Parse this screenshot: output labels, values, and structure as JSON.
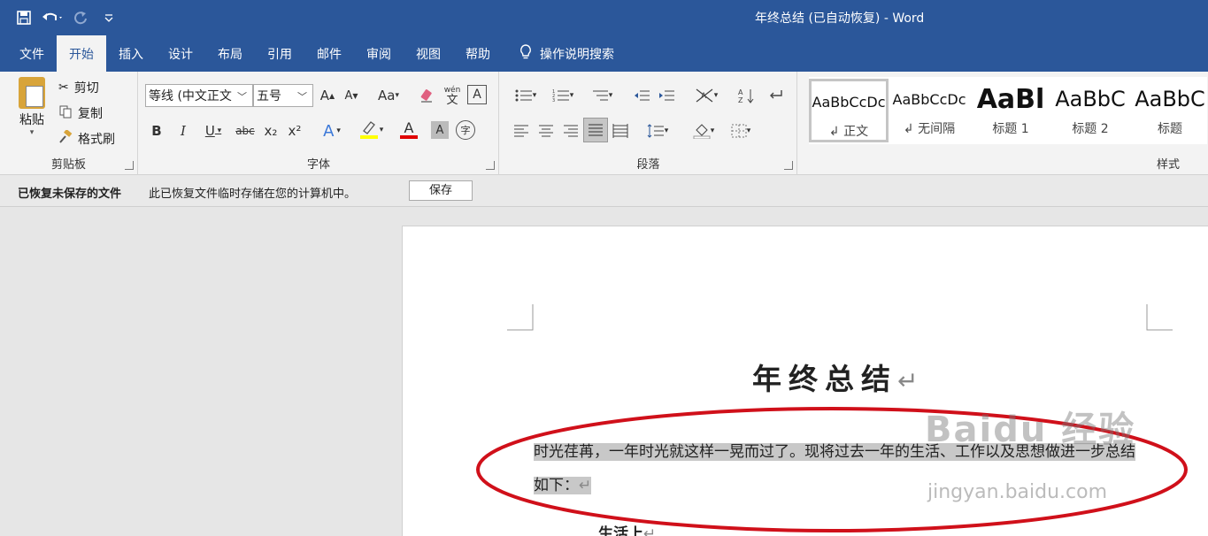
{
  "window": {
    "title": "年终总结 (已自动恢复)  -  Word"
  },
  "qat": {
    "save_icon": "save-icon",
    "undo_icon": "undo-icon",
    "redo_icon": "redo-icon",
    "customize_icon": "chevron-down-icon"
  },
  "tabs": [
    {
      "label": "文件"
    },
    {
      "label": "开始",
      "active": true
    },
    {
      "label": "插入"
    },
    {
      "label": "设计"
    },
    {
      "label": "布局"
    },
    {
      "label": "引用"
    },
    {
      "label": "邮件"
    },
    {
      "label": "审阅"
    },
    {
      "label": "视图"
    },
    {
      "label": "帮助"
    }
  ],
  "tell_me": {
    "label": "操作说明搜索",
    "icon": "lightbulb-icon"
  },
  "clipboard": {
    "paste": "粘贴",
    "cut": "剪切",
    "copy": "复制",
    "format_painter": "格式刷",
    "group_label": "剪贴板"
  },
  "font": {
    "font_name": "等线 (中文正文",
    "font_size": "五号",
    "group_label": "字体",
    "bold": "B",
    "italic": "I",
    "underline": "U",
    "strike": "abc",
    "subscript": "x₂",
    "superscript": "x²",
    "change_case": "Aa",
    "phonetic_top": "wén",
    "phonetic_bottom": "文",
    "char_border": "A",
    "grow": "A",
    "shrink": "A"
  },
  "paragraph": {
    "group_label": "段落"
  },
  "styles": {
    "group_label": "样式",
    "items": [
      {
        "preview": "AaBbCcDc",
        "name": "↲ 正文"
      },
      {
        "preview": "AaBbCcDc",
        "name": "↲ 无间隔"
      },
      {
        "preview": "AaBl",
        "name": "标题 1"
      },
      {
        "preview": "AaBbC",
        "name": "标题 2"
      },
      {
        "preview": "AaBbC",
        "name": "标题"
      }
    ]
  },
  "infobar": {
    "title": "已恢复未保存的文件",
    "message": "此已恢复文件临时存储在您的计算机中。",
    "button": "保存"
  },
  "document": {
    "title": "年终总结",
    "paragraph_line1": "时光荏苒，一年时光就这样一晃而过了。现将过去一年的生活、工作以及思想做进一步总结",
    "paragraph_line2": "如下：",
    "next_heading": "生活上",
    "return_mark": "↵"
  },
  "watermark": {
    "brand": "Baidu 经验",
    "url": "jingyan.baidu.com"
  },
  "colors": {
    "ribbon_blue": "#2b579a",
    "annotation_red": "#d0101a",
    "selection_gray": "#c8c8c8"
  }
}
